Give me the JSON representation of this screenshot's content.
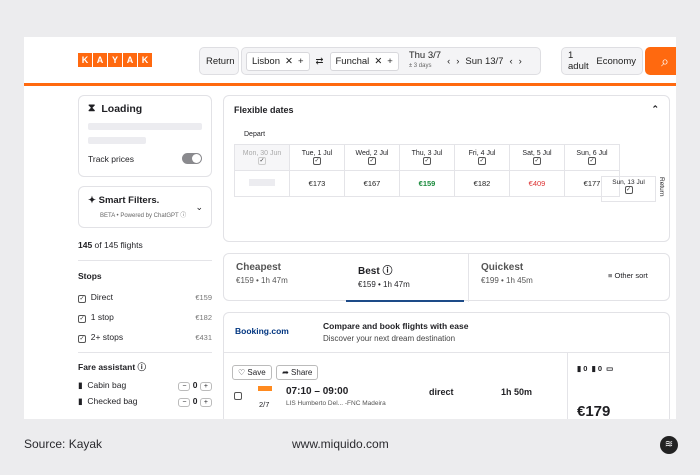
{
  "topbar": {
    "logo_letters": [
      "K",
      "A",
      "Y",
      "A",
      "K"
    ],
    "trip_type": "Return",
    "origin": "Lisbon",
    "destination": "Funchal",
    "depart": "Thu 3/7",
    "flex": "± 3 days",
    "return": "Sun 13/7",
    "travellers": "1 adult",
    "cabin": "Economy"
  },
  "sidebar": {
    "loading": "Loading",
    "track_prices": "Track prices",
    "smart_filters": "Smart Filters.",
    "smart_sub": "BETA • Powered by ChatGPT ⓘ",
    "count_a": "145",
    "count_b": " of 145 flights",
    "stops_title": "Stops",
    "stops": [
      {
        "label": "Direct",
        "price": "€159"
      },
      {
        "label": "1 stop",
        "price": "€182"
      },
      {
        "label": "2+ stops",
        "price": "€431"
      }
    ],
    "fare_title": "Fare assistant ⓘ",
    "bags": [
      {
        "label": "Cabin bag",
        "value": "0"
      },
      {
        "label": "Checked bag",
        "value": "0"
      }
    ]
  },
  "flex": {
    "title": "Flexible dates",
    "depart_label": "Depart",
    "return_label": "Return",
    "days": [
      {
        "d": "Mon, 30 Jun",
        "p": ""
      },
      {
        "d": "Tue, 1 Jul",
        "p": "€173"
      },
      {
        "d": "Wed, 2 Jul",
        "p": "€167"
      },
      {
        "d": "Thu, 3 Jul",
        "p": "€159"
      },
      {
        "d": "Fri, 4 Jul",
        "p": "€182"
      },
      {
        "d": "Sat, 5 Jul",
        "p": "€409"
      },
      {
        "d": "Sun, 6 Jul",
        "p": "€177"
      }
    ],
    "return_day": "Sun, 13 Jul"
  },
  "sort": {
    "cheapest": "Cheapest",
    "cheapest_sub": "€159 • 1h 47m",
    "best": "Best ⓘ",
    "best_sub": "€159 • 1h 47m",
    "quickest": "Quickest",
    "quickest_sub": "€199 • 1h 45m",
    "other": "Other sort"
  },
  "ad": {
    "brand": "Booking.com",
    "title": "Compare and book flights with ease",
    "sub": "Discover your next dream destination"
  },
  "result": {
    "save": "Save",
    "share": "Share",
    "date": "2/7",
    "times": "07:10 – 09:00",
    "route": "LIS Humberto Del... -FNC Madeira",
    "stops": "direct",
    "duration": "1h 50m",
    "bag1": "0",
    "bag2": "0",
    "price": "€179"
  },
  "footer": {
    "source": "Source: Kayak",
    "url": "www.miquido.com"
  }
}
